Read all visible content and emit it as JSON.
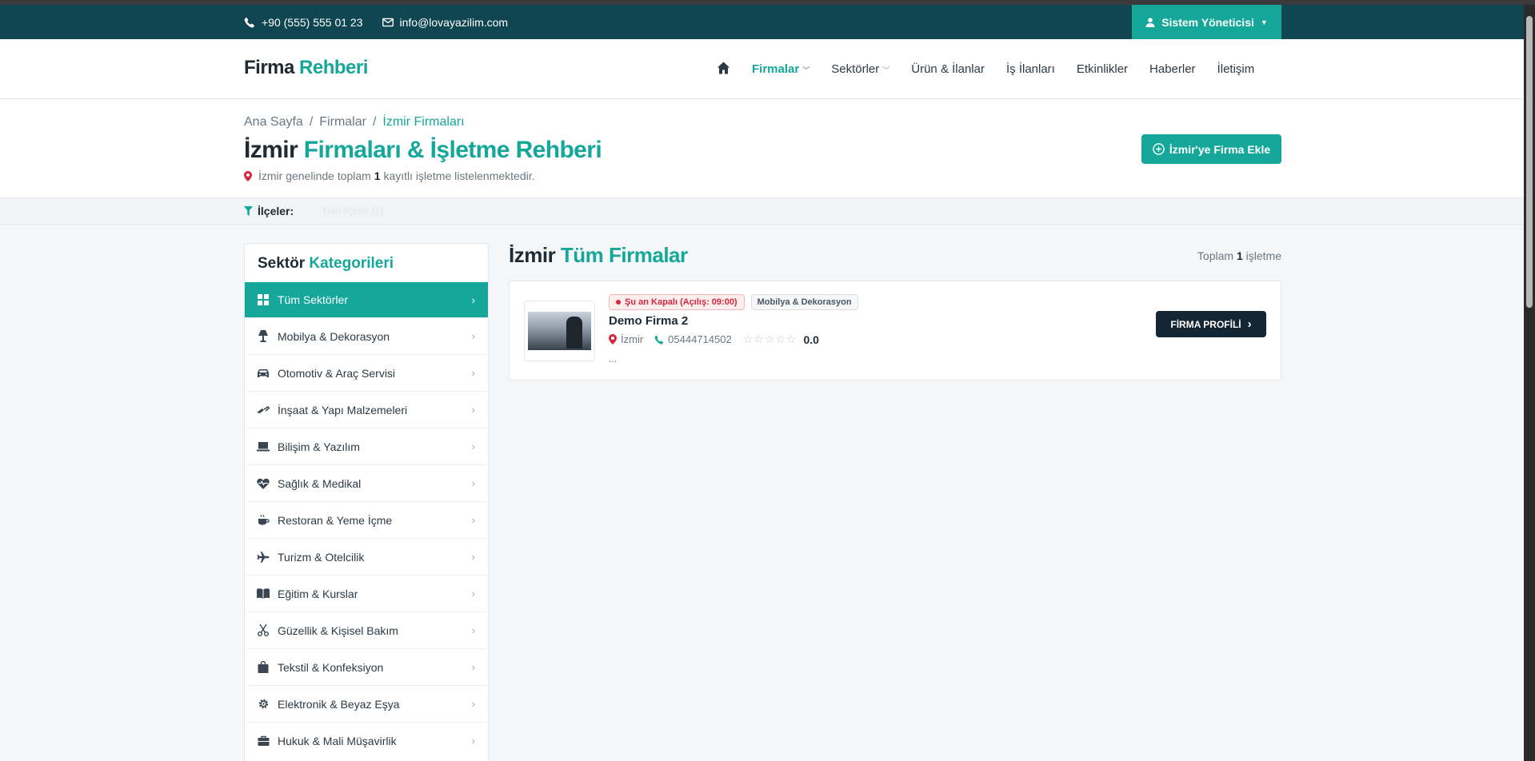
{
  "topbar": {
    "phone": "+90 (555) 555 01 23",
    "email": "info@lovayazilim.com",
    "user_label": "Sistem Yöneticisi"
  },
  "header": {
    "logo_part1": "Firma",
    "logo_part2": "Rehberi",
    "nav": [
      "Firmalar",
      "Sektörler",
      "Ürün & İlanlar",
      "İş İlanları",
      "Etkinlikler",
      "Haberler",
      "İletişim"
    ]
  },
  "hero": {
    "breadcrumb": [
      "Ana Sayfa",
      "Firmalar",
      "İzmir Firmaları"
    ],
    "title_part1": "İzmir",
    "title_part2": "Firmaları & İşletme Rehberi",
    "sub_pre": "İzmir genelinde toplam",
    "sub_count": "1",
    "sub_post": "kayıtlı işletme listelenmektedir.",
    "add_button": "İzmir'ye Firma Ekle"
  },
  "filter": {
    "label": "İlçeler:",
    "ghost_text": "Tüm İlçeler (1)"
  },
  "sidebar": {
    "title_part1": "Sektör",
    "title_part2": "Kategorileri",
    "items": [
      {
        "label": "Tüm Sektörler",
        "icon": "grid-icon"
      },
      {
        "label": "Mobilya & Dekorasyon",
        "icon": "lamp-icon"
      },
      {
        "label": "Otomotiv & Araç Servisi",
        "icon": "car-icon"
      },
      {
        "label": "İnşaat & Yapı Malzemeleri",
        "icon": "trowel-icon"
      },
      {
        "label": "Bilişim & Yazılım",
        "icon": "laptop-icon"
      },
      {
        "label": "Sağlık & Medikal",
        "icon": "heartbeat-icon"
      },
      {
        "label": "Restoran & Yeme İçme",
        "icon": "coffee-icon"
      },
      {
        "label": "Turizm & Otelcilik",
        "icon": "plane-icon"
      },
      {
        "label": "Eğitim & Kurslar",
        "icon": "book-icon"
      },
      {
        "label": "Güzellik & Kişisel Bakım",
        "icon": "scissors-icon"
      },
      {
        "label": "Tekstil & Konfeksiyon",
        "icon": "bag-icon"
      },
      {
        "label": "Elektronik & Beyaz Eşya",
        "icon": "gear-icon"
      },
      {
        "label": "Hukuk & Mali Müşavirlik",
        "icon": "briefcase-icon"
      }
    ]
  },
  "main": {
    "title_part1": "İzmir",
    "title_part2": "Tüm Firmalar",
    "total_pre": "Toplam",
    "total_count": "1",
    "total_post": "işletme"
  },
  "firm": {
    "status": "Şu an Kapalı (Açılış: 09:00)",
    "category": "Mobilya & Dekorasyon",
    "name": "Demo Firma 2",
    "city": "İzmir",
    "phone": "05444714502",
    "stars": "☆☆☆☆☆",
    "rating": "0.0",
    "desc": "...",
    "profile_button": "FİRMA PROFİLİ"
  },
  "colors": {
    "accent": "#14a79a",
    "topbar": "#0f4652",
    "dark_button": "#142633",
    "closed": "#d7263d"
  }
}
